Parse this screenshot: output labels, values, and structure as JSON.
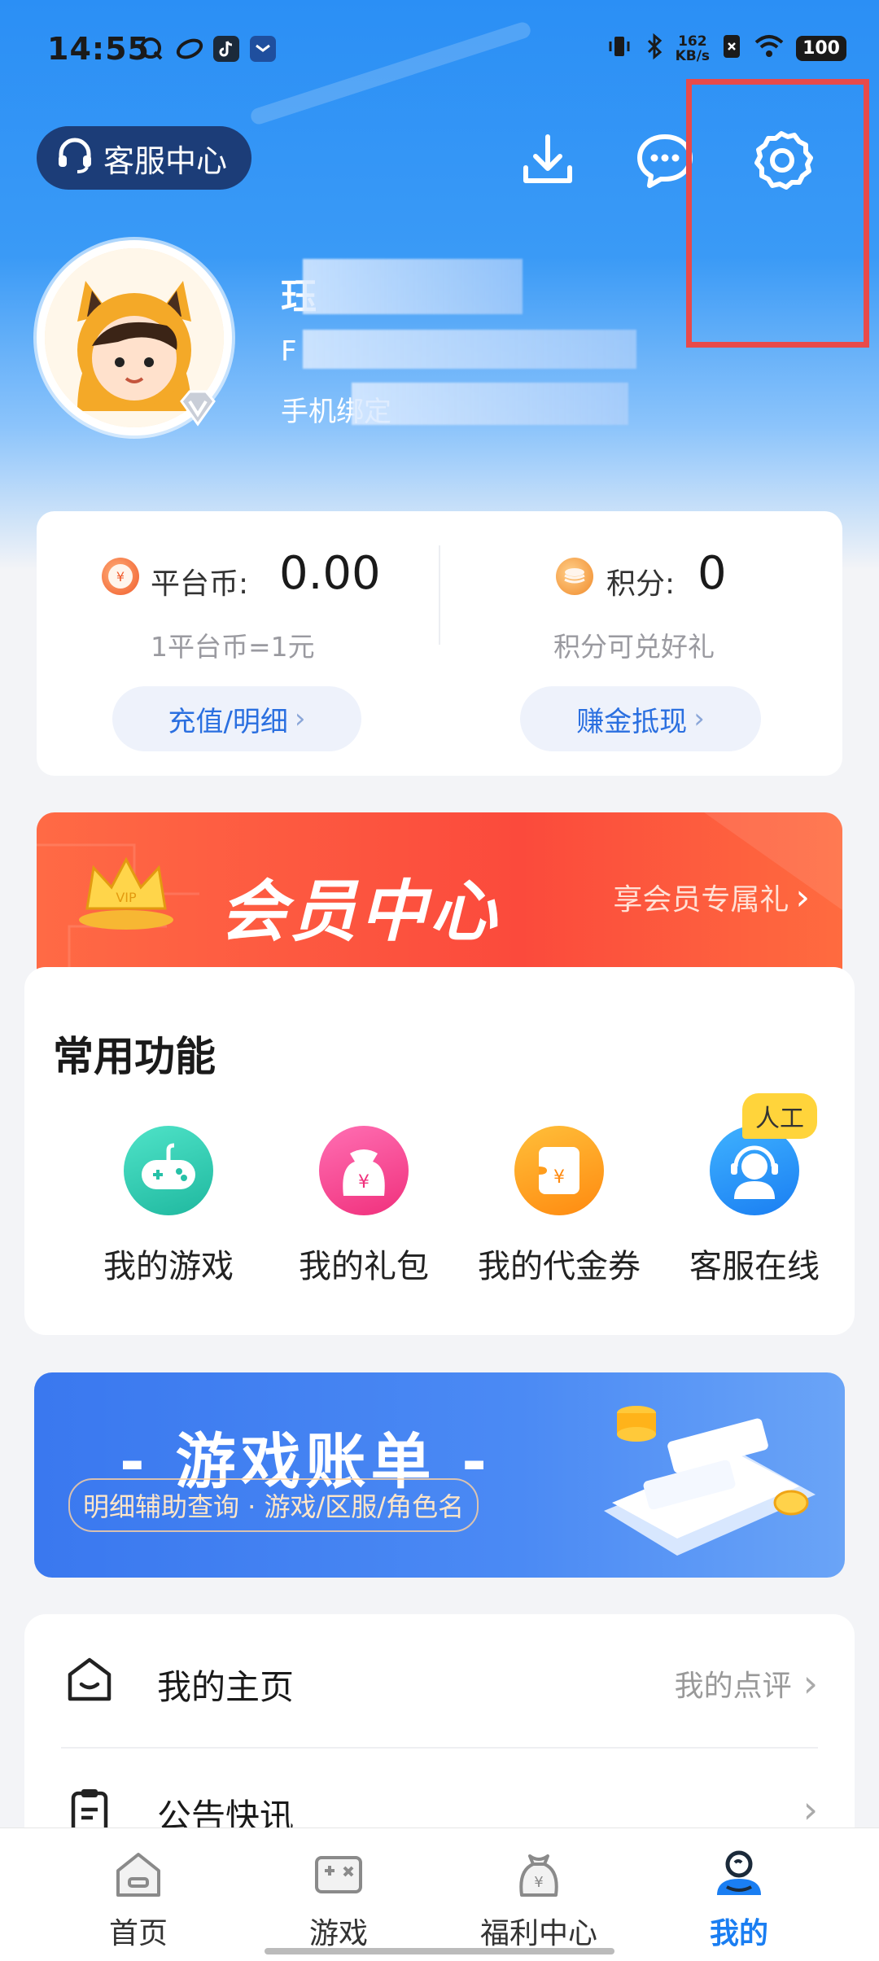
{
  "status_bar": {
    "time": "14:55",
    "net_speed_value": "162",
    "net_speed_unit": "KB/s",
    "battery": "100"
  },
  "header": {
    "customer_service_label": "客服中心"
  },
  "profile": {
    "name_partial": "珏",
    "line2_partial": "F",
    "phone_label": "手机绑定"
  },
  "wallet": {
    "platform_coin_label": "平台币:",
    "platform_coin_value": "0.00",
    "platform_coin_rate": "1平台币=1元",
    "platform_coin_button": "充值/明细",
    "points_label": "积分:",
    "points_value": "0",
    "points_desc": "积分可兑好礼",
    "points_button": "赚金抵现"
  },
  "vip_banner": {
    "title": "会员中心",
    "link": "享会员专属礼"
  },
  "common_functions": {
    "title": "常用功能",
    "items": [
      {
        "label": "我的游戏",
        "icon": "gamepad-icon"
      },
      {
        "label": "我的礼包",
        "icon": "gift-bag-icon"
      },
      {
        "label": "我的代金券",
        "icon": "voucher-icon"
      },
      {
        "label": "客服在线",
        "icon": "headset-agent-icon"
      }
    ],
    "badge": "人工"
  },
  "game_bill_banner": {
    "title": "- 游戏账单 -",
    "subtitle": "明细辅助查询 · 游戏/区服/角色名"
  },
  "list": {
    "rows": [
      {
        "label": "我的主页",
        "right_text": "我的点评"
      },
      {
        "label": "公告快讯",
        "right_text": ""
      }
    ]
  },
  "bottom_nav": {
    "items": [
      {
        "label": "首页",
        "active": false
      },
      {
        "label": "游戏",
        "active": false
      },
      {
        "label": "福利中心",
        "active": false
      },
      {
        "label": "我的",
        "active": true
      }
    ]
  },
  "colors": {
    "accent_blue": "#1a7ef2",
    "vip_red": "#fb4a3c",
    "highlight_red": "#e84a4a"
  }
}
